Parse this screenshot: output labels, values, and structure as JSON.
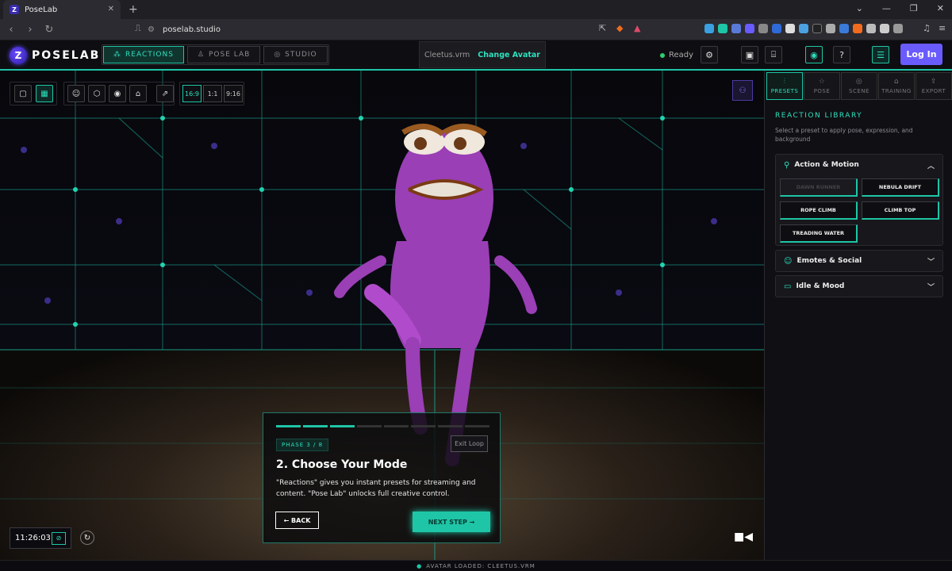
{
  "browser": {
    "tab_title": "PoseLab",
    "tab_favicon": "Z",
    "url": "poselab.studio"
  },
  "app": {
    "logo_text": "POSELAB",
    "logo_mark": "Z",
    "modes": [
      {
        "label": "REACTIONS",
        "icon": "⁂",
        "active": true
      },
      {
        "label": "POSE LAB",
        "icon": "♙",
        "active": false
      },
      {
        "label": "STUDIO",
        "icon": "◎",
        "active": false
      }
    ],
    "avatar_file": "Cleetus.vrm",
    "change_avatar": "Change Avatar",
    "status": "Ready",
    "login": "Log In",
    "accent": "#1ec5a6",
    "brand": "#6a5bff"
  },
  "viewport": {
    "aspect_ratios": [
      "16:9",
      "1:1",
      "9:16"
    ],
    "clock": "11:26:03",
    "onboarding": {
      "phase": "PHASE 3 / 8",
      "progress": 0.375,
      "exit": "Exit Loop",
      "title": "2. Choose Your Mode",
      "description": "\"Reactions\" gives you instant presets for streaming and content. \"Pose Lab\" unlocks full creative control.",
      "back": "← BACK",
      "next": "NEXT STEP →"
    }
  },
  "statusbar": {
    "text": "AVATAR LOADED: CLEETUS.VRM"
  },
  "panel": {
    "tabs": [
      {
        "label": "PRESETS",
        "icon": "⫶",
        "active": true
      },
      {
        "label": "POSE",
        "icon": "☆",
        "active": false
      },
      {
        "label": "SCENE",
        "icon": "◎",
        "active": false
      },
      {
        "label": "TRAINING",
        "icon": "⌂",
        "active": false
      },
      {
        "label": "EXPORT",
        "icon": "⇪",
        "active": false
      }
    ],
    "library_title": "REACTION LIBRARY",
    "library_desc": "Select a preset to apply pose, expression, and background",
    "sections": [
      {
        "title": "Action & Motion",
        "icon": "🏃",
        "expanded": true,
        "presets": [
          "DAWN RUNNER",
          "NEBULA DRIFT",
          "ROPE CLIMB",
          "CLIMB TOP",
          "TREADING WATER"
        ]
      },
      {
        "title": "Emotes & Social",
        "icon": "☺",
        "expanded": false
      },
      {
        "title": "Idle & Mood",
        "icon": "▭",
        "expanded": false
      }
    ]
  }
}
